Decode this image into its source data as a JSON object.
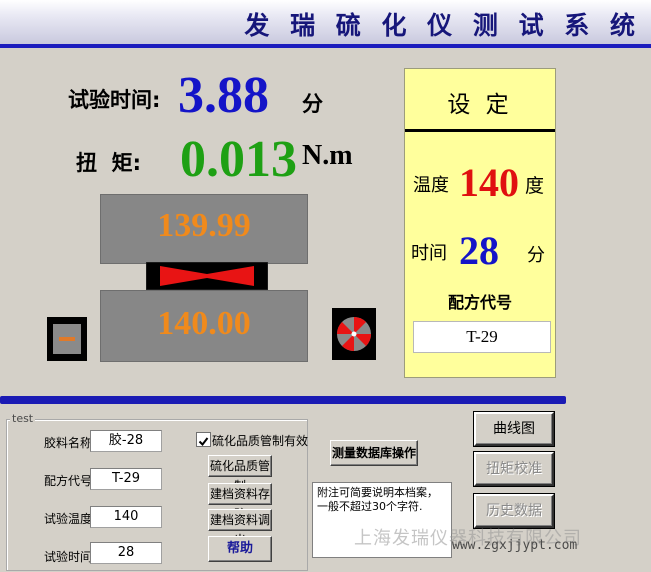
{
  "window": {
    "title": "发 瑞 硫 化 仪 测 试 系 统"
  },
  "status": {
    "test_time_label": "试验时间:",
    "test_time_value": "3.88",
    "test_time_unit": "分",
    "torque_label": "扭  矩:",
    "torque_value": "0.013",
    "torque_unit": "N.m",
    "upper_temp": "139.99",
    "lower_temp": "140.00"
  },
  "settings": {
    "title": "设 定",
    "temp_label": "温度",
    "temp_value": "140",
    "temp_unit": "度",
    "time_label": "时间",
    "time_value": "28",
    "time_unit": "分",
    "code_label": "配方代号",
    "code_value": "T-29"
  },
  "form": {
    "legend": "test",
    "rubber_name_label": "胶料名称",
    "rubber_name_value": "胶-28",
    "formula_code_label": "配方代号",
    "formula_code_value": "T-29",
    "test_temp_label": "试验温度",
    "test_temp_value": "140",
    "test_time_label": "试验时间",
    "test_time_value": "28",
    "quality_checkbox_label": "硫化品质管制有效",
    "quality_checked": true
  },
  "buttons": {
    "quality_control": "硫化品质管制",
    "save_record": "建档资料存贮",
    "load_record": "建档资料调出",
    "help": "帮助",
    "db_operation": "测量数据库操作",
    "curve": "曲线图",
    "torque_calibration": "扭矩校准",
    "history": "历史数据"
  },
  "notes": {
    "text": "附注可简要说明本档案，一般不超过30个字符."
  },
  "watermark": {
    "company": "上海发瑞仪器科技有限公司",
    "url": "www.zgxjjypt.com"
  },
  "colors": {
    "time_value": "#1414c8",
    "torque_value": "#1ea014",
    "temp_value": "#e01010",
    "set_time_value": "#1414c8",
    "platen_value": "#f08a1c",
    "accent_bar": "#1a1ab4"
  }
}
